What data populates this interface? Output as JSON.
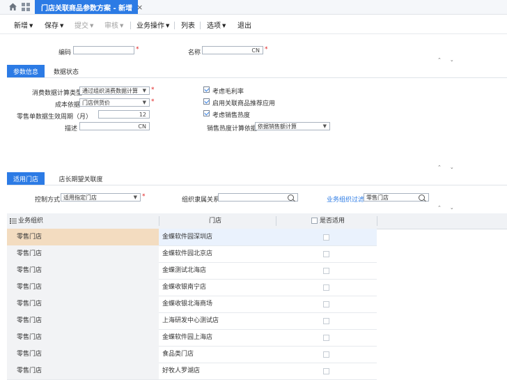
{
  "tabs": {
    "active_label": "门店关联商品参数方案 - 新增",
    "close_symbol": "×"
  },
  "toolbar": {
    "new": "新增",
    "save": "保存",
    "submit": "提交",
    "audit": "审核",
    "business_ops": "业务操作",
    "list": "列表",
    "options": "选项",
    "exit": "退出"
  },
  "header_form": {
    "code_label": "编码",
    "code_value": "",
    "name_label": "名称",
    "name_value": "",
    "lang_suffix": "CN",
    "required_mark": "*"
  },
  "section1": {
    "tab_params": "参数信息",
    "tab_status": "数据状态"
  },
  "params": {
    "consume_calc_label": "消费数据计算类型",
    "consume_calc_value": "通过组织消费数据计算",
    "cost_basis_label": "成本依据",
    "cost_basis_value": "门店供货价",
    "retail_period_label": "零售单数据生效周期（月）",
    "retail_period_value": "12",
    "desc_label": "描述",
    "desc_value": "",
    "lang_suffix": "CN",
    "chk_margin_label": "考虑毛利率",
    "chk_margin_checked": true,
    "chk_recommend_label": "启用关联商品推荐应用",
    "chk_recommend_checked": true,
    "chk_heat_label": "考虑销售热度",
    "chk_heat_checked": true,
    "heat_basis_label": "销售热度计算依据",
    "heat_basis_value": "依据销售额计算"
  },
  "section2": {
    "tab_stores": "适用门店",
    "tab_relevance": "店长期望关联度"
  },
  "store_filter": {
    "control_label": "控制方式",
    "control_value": "适用指定门店",
    "org_relation_label": "组织隶属关系",
    "org_relation_value": "",
    "org_filter_link": "业务组织过滤",
    "org_filter_value": "零售门店"
  },
  "table": {
    "col_org": "业务组织",
    "col_store": "门店",
    "col_applicable": "是否适用",
    "rows": [
      {
        "org": "零售门店",
        "store": "金蝶软件园深圳店",
        "applicable": false
      },
      {
        "org": "零售门店",
        "store": "金蝶软件园北京店",
        "applicable": false
      },
      {
        "org": "零售门店",
        "store": "金蝶测试北海店",
        "applicable": false
      },
      {
        "org": "零售门店",
        "store": "金蝶收银南宁店",
        "applicable": false
      },
      {
        "org": "零售门店",
        "store": "金蝶收银北海商场",
        "applicable": false
      },
      {
        "org": "零售门店",
        "store": "上海研发中心测试店",
        "applicable": false
      },
      {
        "org": "零售门店",
        "store": "金蝶软件园上海店",
        "applicable": false
      },
      {
        "org": "零售门店",
        "store": "食品类门店",
        "applicable": false
      },
      {
        "org": "零售门店",
        "store": "好牧人罗湖店",
        "applicable": false
      }
    ]
  },
  "colors": {
    "accent": "#2c7be5",
    "required": "#e02020",
    "selected_row_org": "#f3dcc0"
  }
}
